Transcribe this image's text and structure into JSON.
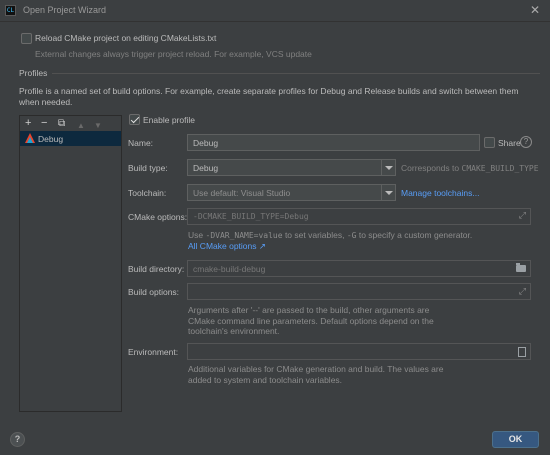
{
  "window": {
    "title": "Open Project Wizard",
    "close_glyph": "✕",
    "app_icon_text": "CL"
  },
  "reload": {
    "label": "Reload CMake project on editing CMakeLists.txt",
    "hint": "External changes always trigger project reload. For example, VCS update",
    "checked": false
  },
  "profiles_section": {
    "title": "Profiles",
    "description": "Profile is a named set of build options. For example, create separate profiles for Debug and Release builds and switch between them when needed."
  },
  "toolbar": {
    "add": "+",
    "remove": "−",
    "copy": "⧉",
    "up": "▲",
    "down": "▼"
  },
  "profiles": [
    {
      "name": "Debug",
      "selected": true
    }
  ],
  "form": {
    "enable_profile_label": "Enable profile",
    "enable_profile_checked": true,
    "name_label": "Name:",
    "name_value": "Debug",
    "share_label": "Share",
    "build_type_label": "Build type:",
    "build_type_value": "Debug",
    "build_type_note_prefix": "Corresponds to",
    "build_type_note_code": "CMAKE_BUILD_TYPE",
    "toolchain_label": "Toolchain:",
    "toolchain_value": "Use default: Visual Studio",
    "manage_toolchains": "Manage toolchains...",
    "cmake_options_label": "CMake options:",
    "cmake_options_value": "-DCMAKE_BUILD_TYPE=Debug",
    "cmake_hint": {
      "t1": "Use",
      "c1": "-DVAR_NAME=value",
      "t2": "to set variables,",
      "c2": "-G",
      "t3": "to specify a custom generator."
    },
    "all_cmake_options": "All CMake options ↗",
    "build_dir_label": "Build directory:",
    "build_dir_value": "cmake-build-debug",
    "build_options_label": "Build options:",
    "build_options_value": "",
    "build_options_hint": [
      "Arguments after '--' are passed to the build, other arguments are",
      "CMake command line parameters. Default options depend on the",
      "toolchain's environment."
    ],
    "environment_label": "Environment:",
    "environment_value": "",
    "environment_hint": [
      "Additional variables for CMake generation and build. The values are",
      "added to system and toolchain variables."
    ]
  },
  "footer": {
    "help": "?",
    "ok": "OK"
  }
}
